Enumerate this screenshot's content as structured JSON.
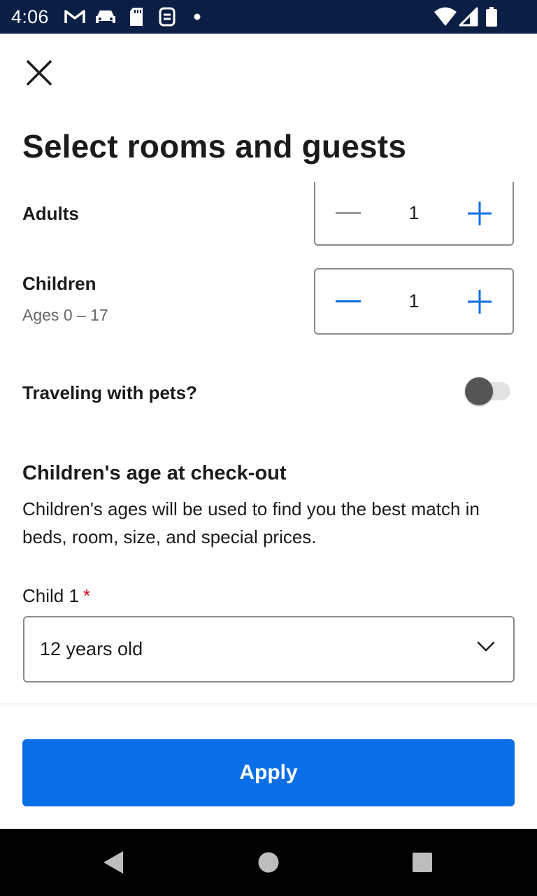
{
  "status_bar": {
    "time": "4:06",
    "icons": [
      "gmail-icon",
      "car-icon",
      "sd-card-icon",
      "sync-icon",
      "notification-dot-icon",
      "wifi-icon",
      "signal-icon",
      "battery-icon"
    ]
  },
  "page": {
    "title": "Select rooms and guests"
  },
  "adults": {
    "label": "Adults",
    "value": "1"
  },
  "children": {
    "label": "Children",
    "sublabel": "Ages 0 – 17",
    "value": "1"
  },
  "pets": {
    "label": "Traveling with pets?",
    "enabled": false
  },
  "children_age": {
    "title": "Children's age at check-out",
    "description": "Children's ages will be used to find you the best match in beds, room, size, and special prices.",
    "child1_label": "Child 1",
    "required_marker": "*",
    "child1_value": "12 years old"
  },
  "footer": {
    "apply_label": "Apply"
  },
  "colors": {
    "status_bar": "#0b1f45",
    "accent": "#0a6fe6",
    "required": "#d0021b",
    "disabled": "#9a9a9a"
  }
}
